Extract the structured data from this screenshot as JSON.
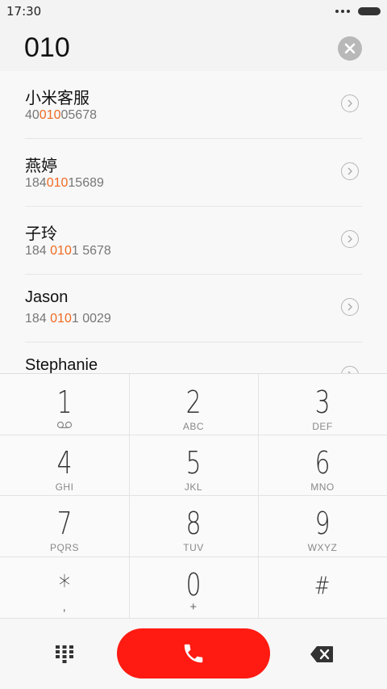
{
  "status_bar": {
    "time": "17:30"
  },
  "dialer": {
    "input_value": "010"
  },
  "results": [
    {
      "name": "小米客服",
      "number_parts": [
        "40",
        "010",
        "05678"
      ]
    },
    {
      "name": "燕婷",
      "number_parts": [
        "184",
        "010",
        "15689"
      ]
    },
    {
      "name": "子玲",
      "number_parts": [
        "184 ",
        "010",
        "1 5678"
      ]
    },
    {
      "name": "Jason",
      "number_parts": [
        "184 ",
        "010",
        "1 0029"
      ]
    },
    {
      "name": "Stephanie",
      "number_parts": [
        "",
        "",
        ""
      ]
    }
  ],
  "keypad": [
    {
      "digit": "1",
      "letters": ""
    },
    {
      "digit": "2",
      "letters": "ABC"
    },
    {
      "digit": "3",
      "letters": "DEF"
    },
    {
      "digit": "4",
      "letters": "GHI"
    },
    {
      "digit": "5",
      "letters": "JKL"
    },
    {
      "digit": "6",
      "letters": "MNO"
    },
    {
      "digit": "7",
      "letters": "PQRS"
    },
    {
      "digit": "8",
      "letters": "TUV"
    },
    {
      "digit": "9",
      "letters": "WXYZ"
    },
    {
      "digit": "*",
      "letters": ","
    },
    {
      "digit": "0",
      "letters": "+"
    },
    {
      "digit": "#",
      "letters": ""
    }
  ],
  "colors": {
    "highlight": "#ef6a22",
    "call_button": "#ff1a12",
    "background": "#f7f7f7"
  },
  "icons": {
    "clear": "clear-icon",
    "detail": "chevron-right-circle-icon",
    "voicemail": "voicemail-icon",
    "call": "phone-icon",
    "dialpad": "dialpad-icon",
    "backspace": "backspace-icon"
  }
}
